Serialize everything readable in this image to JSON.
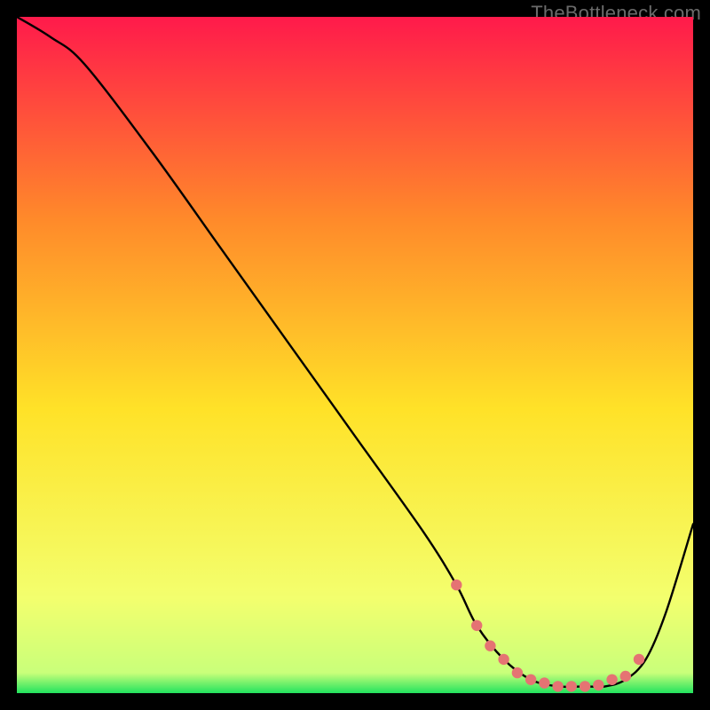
{
  "watermark": "TheBottleneck.com",
  "colors": {
    "top": "#ff1a4b",
    "midTop": "#ff8a2a",
    "mid": "#ffe228",
    "midBot": "#f3ff6e",
    "bottom": "#22e35e",
    "line": "#000000",
    "marker": "#e57373"
  },
  "chart_data": {
    "type": "line",
    "title": "",
    "xlabel": "",
    "ylabel": "",
    "xlim": [
      0,
      100
    ],
    "ylim": [
      0,
      100
    ],
    "grid": false,
    "legend": false,
    "series": [
      {
        "name": "curve",
        "x": [
          0,
          5,
          10,
          20,
          30,
          40,
          50,
          60,
          65,
          68,
          72,
          76,
          80,
          84,
          87,
          90,
          93,
          96,
          100
        ],
        "values": [
          100,
          97,
          93,
          80,
          66,
          52,
          38,
          24,
          16,
          10,
          5,
          2,
          1,
          1,
          1,
          2,
          5,
          12,
          25
        ]
      }
    ],
    "markers": {
      "x": [
        65,
        68,
        70,
        72,
        74,
        76,
        78,
        80,
        82,
        84,
        86,
        88,
        90,
        92
      ],
      "values": [
        16,
        10,
        7,
        5,
        3,
        2,
        1.5,
        1,
        1,
        1,
        1.2,
        2,
        2.5,
        5
      ]
    }
  }
}
